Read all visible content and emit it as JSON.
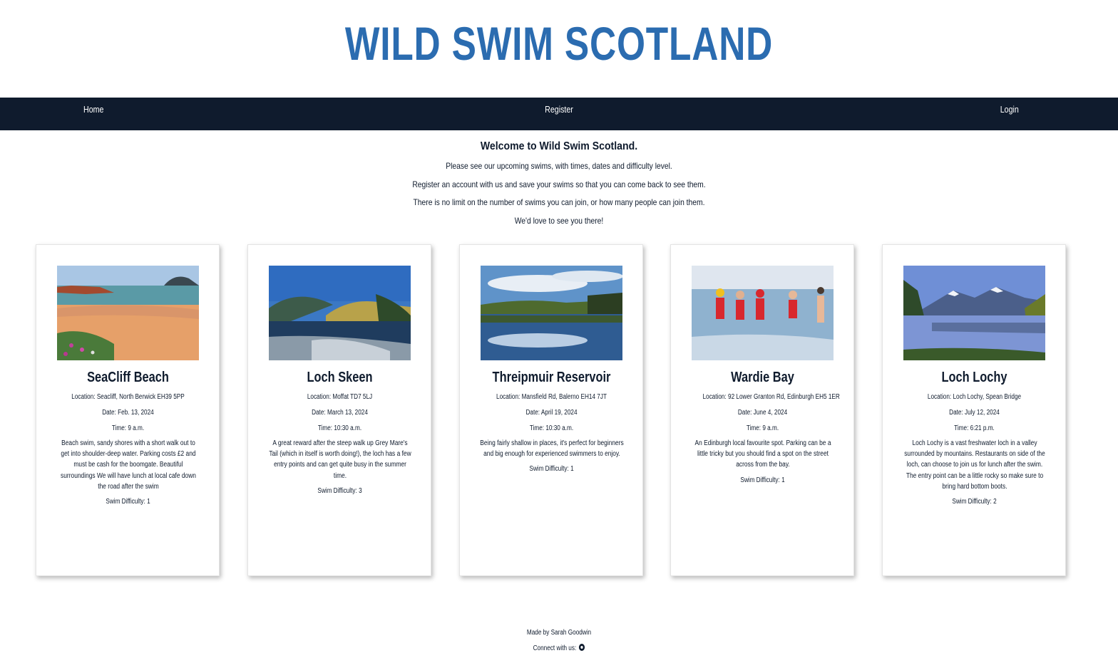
{
  "site": {
    "logo_text": "WILD SWIM SCOTLAND",
    "brand_color": "#2b6cb0",
    "nav_color": "#0f1b2d"
  },
  "nav": {
    "home": "Home",
    "register": "Register",
    "login": "Login"
  },
  "welcome": {
    "title": "Welcome to Wild Swim Scotland.",
    "lines": [
      "Please see our upcoming swims, with times, dates and difficulty level.",
      "Register an account with us and save your swims so that you can come back to see them.",
      "There is no limit on the number of swims you can join, or how many people can join them.",
      "We'd love to see you there!"
    ]
  },
  "swims": [
    {
      "name": "SeaCliff Beach",
      "location": "Location: Seacliff, North Berwick EH39 5PP",
      "date": "Date: Feb. 13, 2024",
      "time": "Time: 9 a.m.",
      "description": "Beach swim, sandy shores with a short walk out to get into shoulder-deep water. Parking costs £2 and must be cash for the boomgate. Beautiful surroundings We will have lunch at local cafe down the road after the swim",
      "difficulty": "Swim Difficulty: 1",
      "image_icon": "beach-photo"
    },
    {
      "name": "Loch Skeen",
      "location": "Location: Moffat TD7 5LJ",
      "date": "Date: March 13, 2024",
      "time": "Time: 10:30 a.m.",
      "description": "A great reward after the steep walk up Grey Mare's Tail (which in itself is worth doing!), the loch has a few entry points and can get quite busy in the summer time.",
      "difficulty": "Swim Difficulty: 3",
      "image_icon": "loch-photo"
    },
    {
      "name": "Threipmuir Reservoir",
      "location": "Location: Mansfield Rd, Balerno EH14 7JT",
      "date": "Date: April 19, 2024",
      "time": "Time: 10:30 a.m.",
      "description": "Being fairly shallow in places, it's perfect for beginners and big enough for experienced swimmers to enjoy.",
      "difficulty": "Swim Difficulty: 1",
      "image_icon": "reservoir-photo"
    },
    {
      "name": "Wardie Bay",
      "location": "Location: 92 Lower Granton Rd, Edinburgh EH5 1ER",
      "date": "Date: June 4, 2024",
      "time": "Time: 9 a.m.",
      "description": "An Edinburgh local favourite spot. Parking can be a little tricky but you should find a spot on the street across from the bay.",
      "difficulty": "Swim Difficulty: 1",
      "image_icon": "swimmers-photo"
    },
    {
      "name": "Loch Lochy",
      "location": "Location: Loch Lochy, Spean Bridge",
      "date": "Date: July 12, 2024",
      "time": "Time: 6:21 p.m.",
      "description": "Loch Lochy is a vast freshwater loch in a valley surrounded by mountains. Restaurants on side of the loch, can choose to join us for lunch after the swim. The entry point can be a little rocky so make sure to bring hard bottom boots.",
      "difficulty": "Swim Difficulty: 2",
      "image_icon": "mountain-loch-photo"
    }
  ],
  "footer": {
    "made_by": "Made by Sarah Goodwin",
    "connect": "Connect with us:",
    "connect_icon": "github-icon"
  }
}
